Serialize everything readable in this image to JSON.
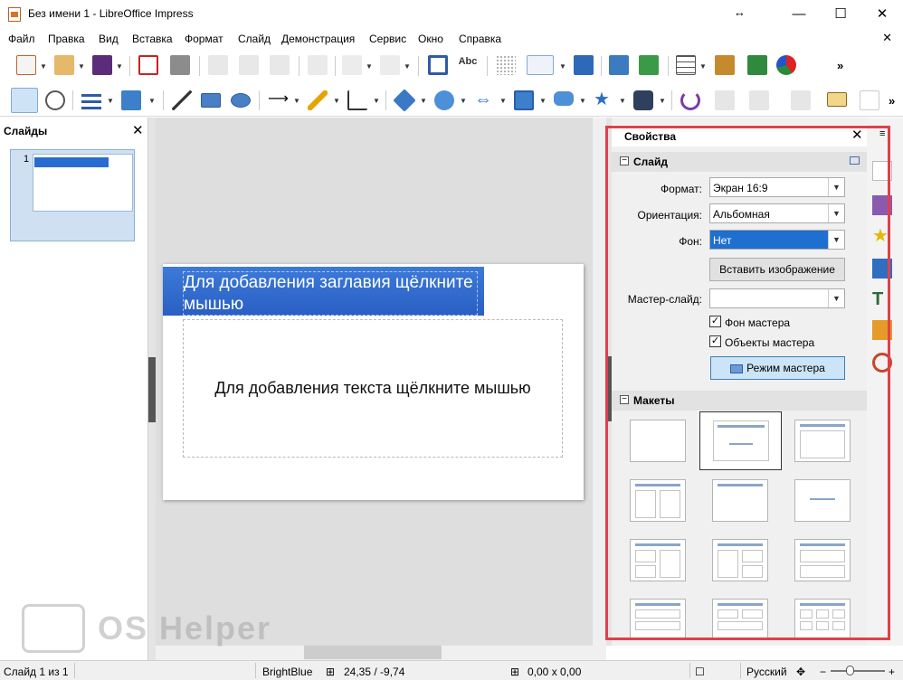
{
  "window": {
    "title": "Без имени 1 - LibreOffice Impress"
  },
  "menu": [
    "Файл",
    "Правка",
    "Вид",
    "Вставка",
    "Формат",
    "Слайд",
    "Демонстрация",
    "Сервис",
    "Окно",
    "Справка"
  ],
  "slides_pane": {
    "title": "Слайды",
    "thumb_number": "1"
  },
  "slide": {
    "title_placeholder": "Для добавления заглавия щёлкните мышью",
    "body_placeholder": "Для добавления текста щёлкните мышью"
  },
  "properties": {
    "title": "Свойства",
    "slide_section": "Слайд",
    "format_label": "Формат:",
    "format_value": "Экран 16:9",
    "orientation_label": "Ориентация:",
    "orientation_value": "Альбомная",
    "background_label": "Фон:",
    "background_value": "Нет",
    "insert_image": "Вставить изображение",
    "master_label": "Мастер-слайд:",
    "master_value": "",
    "master_bg": "Фон мастера",
    "master_objects": "Объекты мастера",
    "master_mode": "Режим мастера",
    "layouts_section": "Макеты"
  },
  "status": {
    "slide": "Слайд 1 из 1",
    "theme": "BrightBlue",
    "position": "24,35 / -9,74",
    "size": "0,00 x 0,00",
    "language": "Русский"
  },
  "watermark": "OS Helper",
  "colors": {
    "accent": "#2a6bd2",
    "highlight": "#e0404a"
  }
}
